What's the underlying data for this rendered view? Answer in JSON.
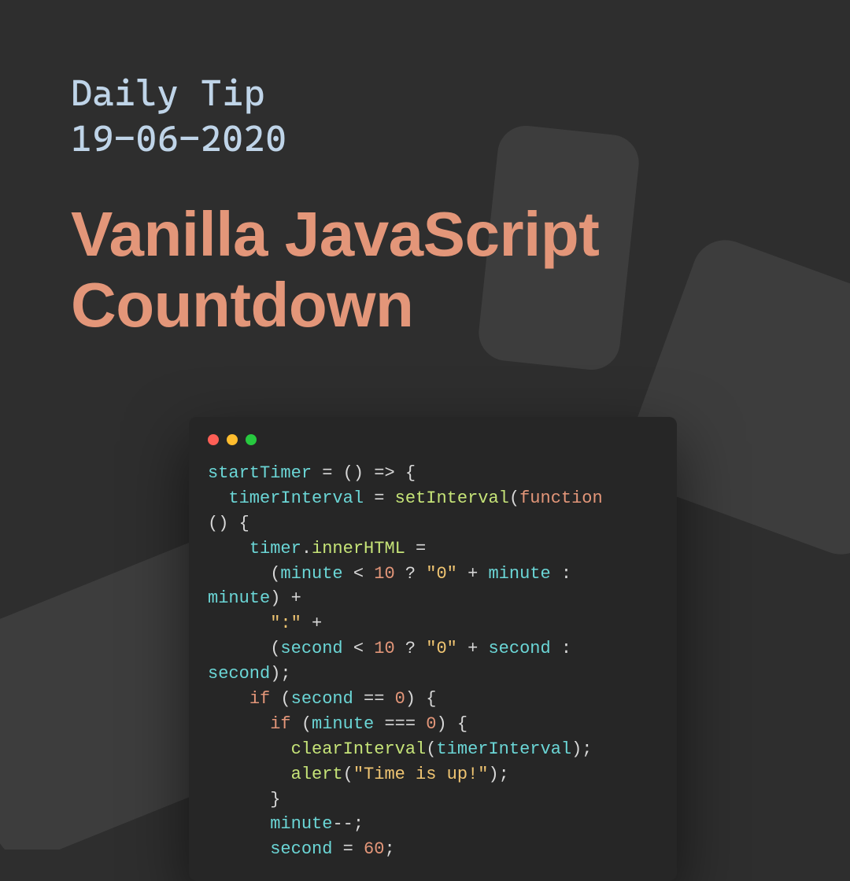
{
  "header": {
    "subtitle_line1": "Daily Tip",
    "subtitle_line2": "19-06-2020",
    "title_line1": "Vanilla JavaScript",
    "title_line2": "Countdown"
  },
  "code": {
    "tokens": [
      {
        "t": "startTimer",
        "c": "c-var"
      },
      {
        "t": " = () => {",
        "c": "c-op"
      },
      {
        "t": "\n",
        "c": ""
      },
      {
        "t": "  ",
        "c": ""
      },
      {
        "t": "timerInterval",
        "c": "c-var"
      },
      {
        "t": " = ",
        "c": "c-op"
      },
      {
        "t": "setInterval",
        "c": "c-fn"
      },
      {
        "t": "(",
        "c": "c-punc"
      },
      {
        "t": "function",
        "c": "c-kw"
      },
      {
        "t": "\n",
        "c": ""
      },
      {
        "t": "() {",
        "c": "c-op"
      },
      {
        "t": "\n",
        "c": ""
      },
      {
        "t": "    ",
        "c": ""
      },
      {
        "t": "timer",
        "c": "c-var"
      },
      {
        "t": ".",
        "c": "c-punc"
      },
      {
        "t": "innerHTML",
        "c": "c-id"
      },
      {
        "t": " =",
        "c": "c-op"
      },
      {
        "t": "\n",
        "c": ""
      },
      {
        "t": "      (",
        "c": "c-punc"
      },
      {
        "t": "minute",
        "c": "c-var"
      },
      {
        "t": " < ",
        "c": "c-op"
      },
      {
        "t": "10",
        "c": "c-num"
      },
      {
        "t": " ? ",
        "c": "c-op"
      },
      {
        "t": "\"0\"",
        "c": "c-str"
      },
      {
        "t": " + ",
        "c": "c-op"
      },
      {
        "t": "minute",
        "c": "c-var"
      },
      {
        "t": " :",
        "c": "c-op"
      },
      {
        "t": "\n",
        "c": ""
      },
      {
        "t": "minute",
        "c": "c-var"
      },
      {
        "t": ") +",
        "c": "c-punc"
      },
      {
        "t": "\n",
        "c": ""
      },
      {
        "t": "      ",
        "c": ""
      },
      {
        "t": "\":\"",
        "c": "c-str"
      },
      {
        "t": " +",
        "c": "c-op"
      },
      {
        "t": "\n",
        "c": ""
      },
      {
        "t": "      (",
        "c": "c-punc"
      },
      {
        "t": "second",
        "c": "c-var"
      },
      {
        "t": " < ",
        "c": "c-op"
      },
      {
        "t": "10",
        "c": "c-num"
      },
      {
        "t": " ? ",
        "c": "c-op"
      },
      {
        "t": "\"0\"",
        "c": "c-str"
      },
      {
        "t": " + ",
        "c": "c-op"
      },
      {
        "t": "second",
        "c": "c-var"
      },
      {
        "t": " :",
        "c": "c-op"
      },
      {
        "t": "\n",
        "c": ""
      },
      {
        "t": "second",
        "c": "c-var"
      },
      {
        "t": ");",
        "c": "c-punc"
      },
      {
        "t": "\n",
        "c": ""
      },
      {
        "t": "    ",
        "c": ""
      },
      {
        "t": "if",
        "c": "c-kw"
      },
      {
        "t": " (",
        "c": "c-punc"
      },
      {
        "t": "second",
        "c": "c-var"
      },
      {
        "t": " == ",
        "c": "c-op"
      },
      {
        "t": "0",
        "c": "c-num"
      },
      {
        "t": ") {",
        "c": "c-punc"
      },
      {
        "t": "\n",
        "c": ""
      },
      {
        "t": "      ",
        "c": ""
      },
      {
        "t": "if",
        "c": "c-kw"
      },
      {
        "t": " (",
        "c": "c-punc"
      },
      {
        "t": "minute",
        "c": "c-var"
      },
      {
        "t": " === ",
        "c": "c-op"
      },
      {
        "t": "0",
        "c": "c-num"
      },
      {
        "t": ") {",
        "c": "c-punc"
      },
      {
        "t": "\n",
        "c": ""
      },
      {
        "t": "        ",
        "c": ""
      },
      {
        "t": "clearInterval",
        "c": "c-fn"
      },
      {
        "t": "(",
        "c": "c-punc"
      },
      {
        "t": "timerInterval",
        "c": "c-var"
      },
      {
        "t": ");",
        "c": "c-punc"
      },
      {
        "t": "\n",
        "c": ""
      },
      {
        "t": "        ",
        "c": ""
      },
      {
        "t": "alert",
        "c": "c-fn"
      },
      {
        "t": "(",
        "c": "c-punc"
      },
      {
        "t": "\"Time is up!\"",
        "c": "c-str"
      },
      {
        "t": ");",
        "c": "c-punc"
      },
      {
        "t": "\n",
        "c": ""
      },
      {
        "t": "      }",
        "c": "c-punc"
      },
      {
        "t": "\n",
        "c": ""
      },
      {
        "t": "      ",
        "c": ""
      },
      {
        "t": "minute",
        "c": "c-var"
      },
      {
        "t": "--;",
        "c": "c-op"
      },
      {
        "t": "\n",
        "c": ""
      },
      {
        "t": "      ",
        "c": ""
      },
      {
        "t": "second",
        "c": "c-var"
      },
      {
        "t": " = ",
        "c": "c-op"
      },
      {
        "t": "60",
        "c": "c-num"
      },
      {
        "t": ";",
        "c": "c-punc"
      }
    ]
  },
  "colors": {
    "background": "#2e2e2e",
    "code_background": "#262626",
    "subtitle": "#bfd4e8",
    "title": "#e39679",
    "shape": "#4a4a4a",
    "traffic_red": "#ff5f56",
    "traffic_yellow": "#ffbd2e",
    "traffic_green": "#27c93f"
  }
}
